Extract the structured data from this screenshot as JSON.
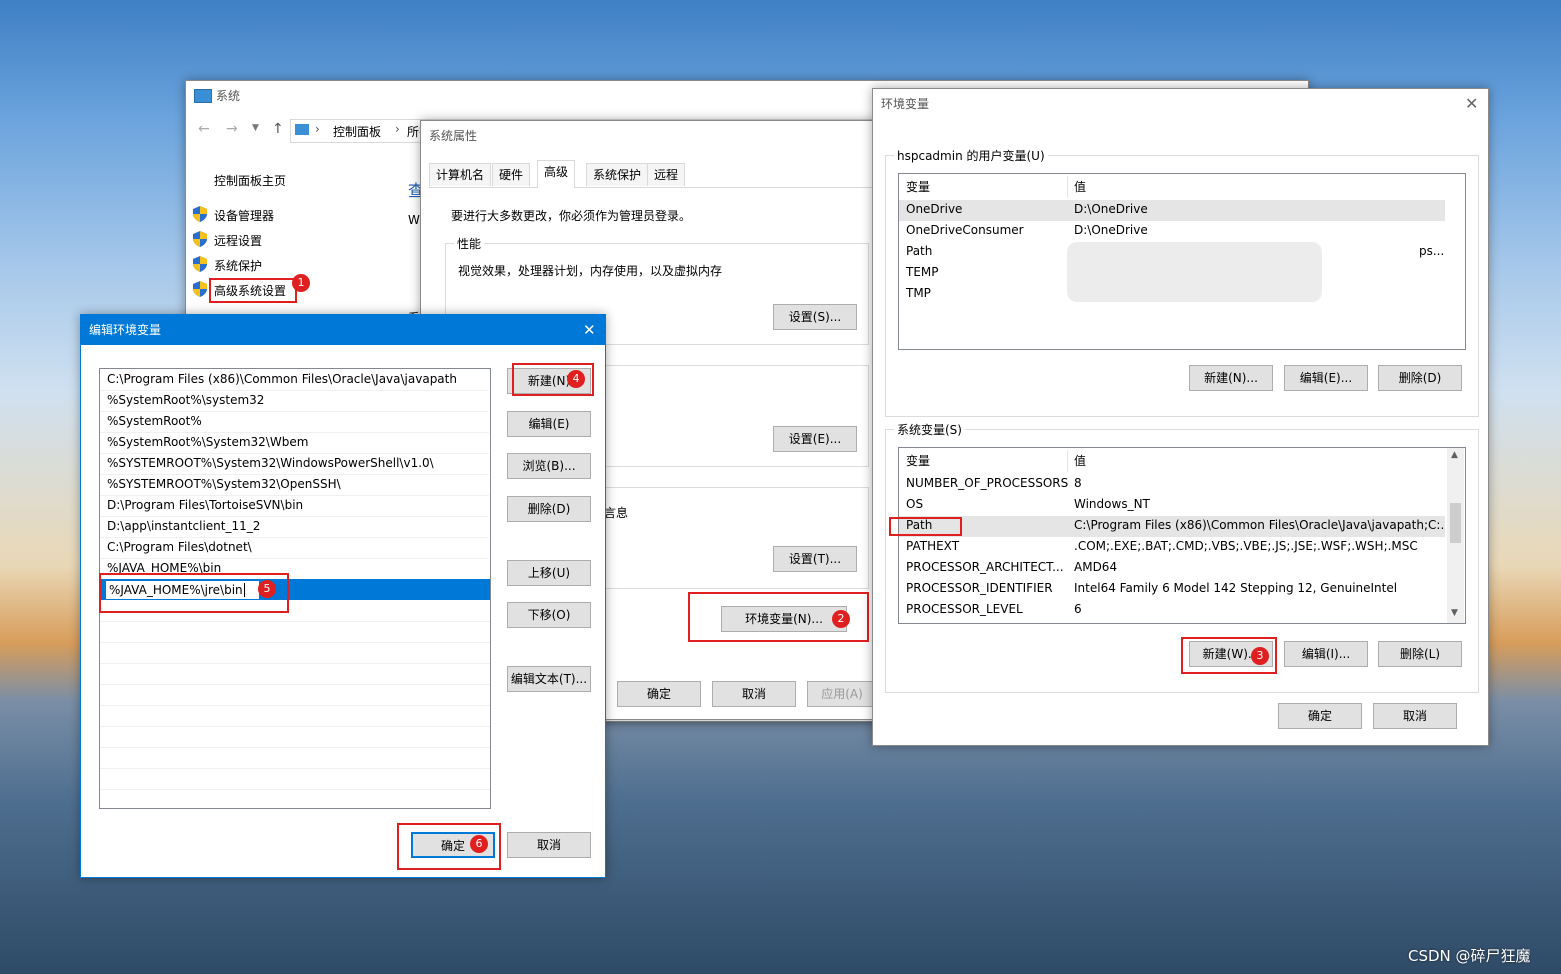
{
  "system_window": {
    "title": "系统",
    "breadcrumb": [
      "控制面板",
      "所有"
    ],
    "sidebar_home": "控制面板主页",
    "sidebar_items": [
      "设备管理器",
      "远程设置",
      "系统保护",
      "高级系统设置"
    ],
    "partial_text_1": "查",
    "partial_text_2": "W",
    "partial_text_3": "系"
  },
  "sys_props": {
    "title": "系统属性",
    "tabs": [
      "计算机名",
      "硬件",
      "高级",
      "系统保护",
      "远程"
    ],
    "active_tab": "高级",
    "admin_note": "要进行大多数更改，你必须作为管理员登录。",
    "perf_group": "性能",
    "perf_desc": "视觉效果，处理器计划，内存使用，以及虚拟内存",
    "settings_s": "设置(S)...",
    "settings_e": "设置(E)...",
    "partial_info": "言息",
    "settings_t": "设置(T)...",
    "env_btn": "环境变量(N)...",
    "ok": "确定",
    "cancel": "取消",
    "apply": "应用(A)"
  },
  "env_vars": {
    "title": "环境变量",
    "user_group": "hspcadmin 的用户变量(U)",
    "col_var": "变量",
    "col_val": "值",
    "user_rows": [
      {
        "name": "OneDrive",
        "value": "D:\\OneDrive"
      },
      {
        "name": "OneDriveConsumer",
        "value": "D:\\OneDrive"
      },
      {
        "name": "Path",
        "value": "ps..."
      },
      {
        "name": "TEMP",
        "value": ""
      },
      {
        "name": "TMP",
        "value": ""
      }
    ],
    "user_new": "新建(N)...",
    "user_edit": "编辑(E)...",
    "user_delete": "删除(D)",
    "sys_group": "系统变量(S)",
    "sys_rows": [
      {
        "name": "NUMBER_OF_PROCESSORS",
        "value": "8"
      },
      {
        "name": "OS",
        "value": "Windows_NT"
      },
      {
        "name": "Path",
        "value": "C:\\Program Files (x86)\\Common Files\\Oracle\\Java\\javapath;C:..."
      },
      {
        "name": "PATHEXT",
        "value": ".COM;.EXE;.BAT;.CMD;.VBS;.VBE;.JS;.JSE;.WSF;.WSH;.MSC"
      },
      {
        "name": "PROCESSOR_ARCHITECT...",
        "value": "AMD64"
      },
      {
        "name": "PROCESSOR_IDENTIFIER",
        "value": "Intel64 Family 6 Model 142 Stepping 12, GenuineIntel"
      },
      {
        "name": "PROCESSOR_LEVEL",
        "value": "6"
      }
    ],
    "sys_new": "新建(W)...",
    "sys_edit": "编辑(I)...",
    "sys_delete": "删除(L)",
    "ok": "确定",
    "cancel": "取消"
  },
  "edit_env": {
    "title": "编辑环境变量",
    "entries": [
      "C:\\Program Files (x86)\\Common Files\\Oracle\\Java\\javapath",
      "%SystemRoot%\\system32",
      "%SystemRoot%",
      "%SystemRoot%\\System32\\Wbem",
      "%SYSTEMROOT%\\System32\\WindowsPowerShell\\v1.0\\",
      "%SYSTEMROOT%\\System32\\OpenSSH\\",
      "D:\\Program Files\\TortoiseSVN\\bin",
      "D:\\app\\instantclient_11_2",
      "C:\\Program Files\\dotnet\\",
      "%JAVA_HOME%\\bin"
    ],
    "editing_value": "%JAVA_HOME%\\jre\\bin",
    "new": "新建(N)",
    "edit": "编辑(E)",
    "browse": "浏览(B)...",
    "delete": "删除(D)",
    "move_up": "上移(U)",
    "move_down": "下移(O)",
    "edit_text": "编辑文本(T)...",
    "ok": "确定",
    "cancel": "取消"
  },
  "badges": [
    "1",
    "2",
    "3",
    "4",
    "5",
    "6"
  ],
  "watermark": "CSDN @碎尸狂魔",
  "colors": {
    "selection": "#0078d7",
    "annotation": "#e02020",
    "titlebar_active": "#0078d7"
  }
}
